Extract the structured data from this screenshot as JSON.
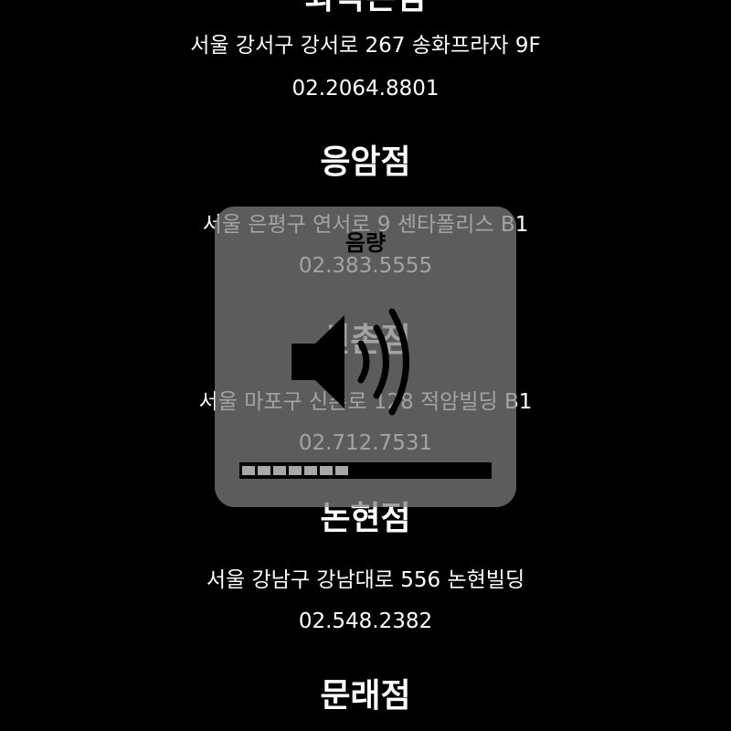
{
  "stores": [
    {
      "name": "화곡본점",
      "address": "서울 강서구 강서로 267 송화프라자 9F",
      "phone": "02.2064.8801"
    },
    {
      "name": "응암점",
      "address": "서울 은평구 연서로 9 센타폴리스 B1",
      "phone": "02.383.5555"
    },
    {
      "name": "신촌점",
      "address": "서울 마포구 신촌로 128 적암빌딩 B1",
      "phone": "02.712.7531"
    },
    {
      "name": "논현점",
      "address": "서울 강남구 강남대로 556 논현빌딩",
      "phone": "02.548.2382"
    },
    {
      "name": "문래점",
      "address": "",
      "phone": ""
    }
  ],
  "volume_overlay": {
    "title": "음량",
    "icon": "speaker-volume-icon",
    "level_fraction": 0.44,
    "level_segments_filled": 7
  }
}
